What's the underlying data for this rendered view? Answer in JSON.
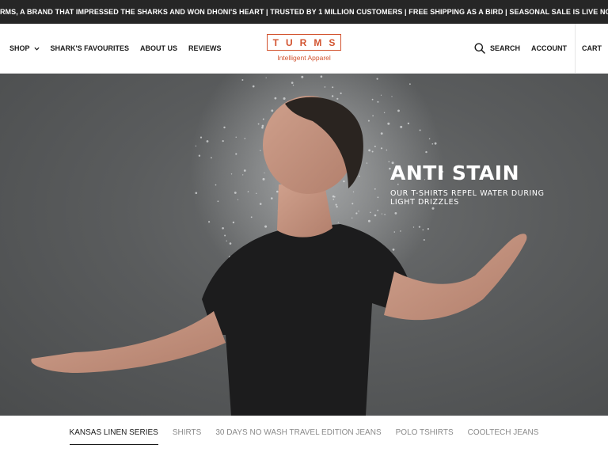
{
  "announcement": "TURMS, A BRAND THAT IMPRESSED THE SHARKS AND WON DHONI'S HEART | TRUSTED BY 1 MILLION CUSTOMERS | FREE SHIPPING AS A BIRD | SEASONAL SALE IS LIVE NOW",
  "nav": {
    "shop": "SHOP",
    "sharks_favourites": "SHARK'S FAVOURITES",
    "about_us": "ABOUT US",
    "reviews": "REVIEWS"
  },
  "logo": {
    "name": "TURMS",
    "tagline": "Intelligent Apparel"
  },
  "header_right": {
    "search": "SEARCH",
    "account": "ACCOUNT",
    "cart": "CART"
  },
  "hero": {
    "title": "ANTI STAIN",
    "subtitle": "OUR T-SHIRTS REPEL WATER DURING LIGHT DRIZZLES"
  },
  "collection_tabs": [
    {
      "label": "KANSAS LINEN SERIES",
      "active": true
    },
    {
      "label": "SHIRTS",
      "active": false
    },
    {
      "label": "30 DAYS NO WASH TRAVEL EDITION JEANS",
      "active": false
    },
    {
      "label": "POLO TSHIRTS",
      "active": false
    },
    {
      "label": "COOLTECH JEANS",
      "active": false
    }
  ],
  "colors": {
    "brand": "#d2532f",
    "announcement_bg": "#262626",
    "hero_bg": "#5a5c5d"
  },
  "icons": [
    "chevron-down-icon",
    "search-icon"
  ]
}
